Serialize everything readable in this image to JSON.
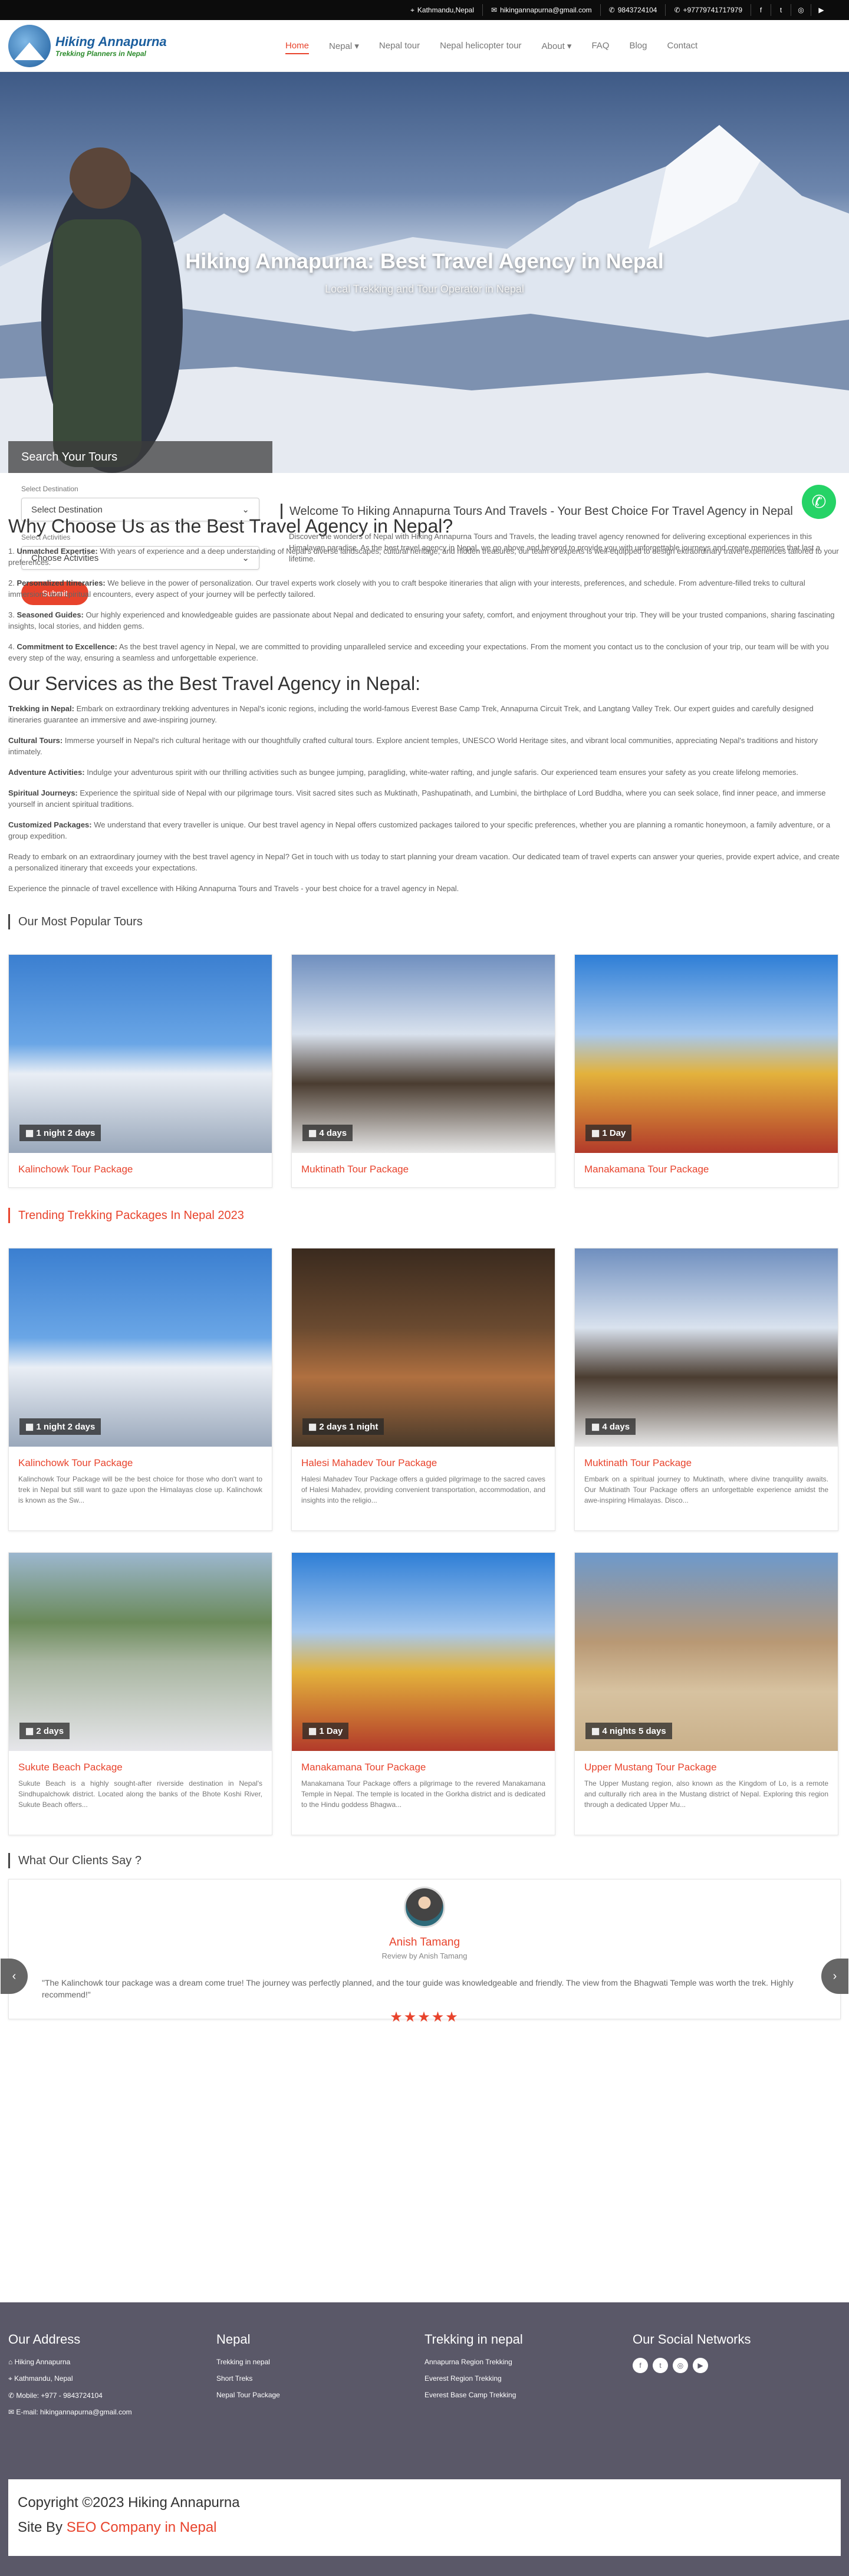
{
  "topbar": {
    "location": "Kathmandu,Nepal",
    "email": "hikingannapurna@gmail.com",
    "phone1": "9843724104",
    "phone2": "+97779741717979"
  },
  "logo": {
    "title": "Hiking Annapurna",
    "tagline": "Trekking Planners in Nepal"
  },
  "nav": [
    "Home",
    "Nepal ▾",
    "Nepal tour",
    "Nepal helicopter tour",
    "About ▾",
    "FAQ",
    "Blog",
    "Contact"
  ],
  "hero": {
    "title": "Hiking Annapurna: Best Travel Agency in Nepal",
    "subtitle": "Local Trekking and Tour Operator in Nepal"
  },
  "search": {
    "title": "Search Your Tours",
    "dest_label": "Select Destination",
    "dest_value": "Select Destination",
    "act_label": "Select Activities",
    "act_value": "Choose Activities",
    "submit": "Submit"
  },
  "welcome": {
    "title": "Welcome To Hiking Annapurna Tours And Travels - Your Best Choice For Travel Agency in Nepal",
    "text": "Discover the wonders of Nepal with Hiking Annapurna Tours and Travels, the leading travel agency renowned for delivering exceptional experiences in this Himalayan paradise. As the best travel agency in Nepal, we go above and beyond to provide you with unforgettable journeys and create memories that last a lifetime."
  },
  "why": {
    "title": "Why Choose Us as the Best Travel Agency in Nepal?",
    "items": [
      {
        "n": "1.",
        "h": "Unmatched Expertise:",
        "t": "With years of experience and a deep understanding of Nepal's diverse landscapes, cultural heritage, and hidden treasures, our team of experts is well-equipped to design extraordinary travel experiences tailored to your preferences."
      },
      {
        "n": "2.",
        "h": "Personalized Itineraries:",
        "t": "We believe in the power of personalization. Our travel experts work closely with you to craft bespoke itineraries that align with your interests, preferences, and schedule. From adventure-filled treks to cultural immersions and spiritual encounters, every aspect of your journey will be perfectly tailored."
      },
      {
        "n": "3.",
        "h": "Seasoned Guides:",
        "t": "Our highly experienced and knowledgeable guides are passionate about Nepal and dedicated to ensuring your safety, comfort, and enjoyment throughout your trip. They will be your trusted companions, sharing fascinating insights, local stories, and hidden gems."
      },
      {
        "n": "4.",
        "h": "Commitment to Excellence:",
        "t": "As the best travel agency in Nepal, we are committed to providing unparalleled service and exceeding your expectations. From the moment you contact us to the conclusion of your trip, our team will be with you every step of the way, ensuring a seamless and unforgettable experience."
      }
    ]
  },
  "services": {
    "title": "Our Services as the Best Travel Agency in Nepal:",
    "items": [
      {
        "h": "Trekking in Nepal:",
        "t": "Embark on extraordinary trekking adventures in Nepal's iconic regions, including the world-famous Everest Base Camp Trek, Annapurna Circuit Trek, and Langtang Valley Trek. Our expert guides and carefully designed itineraries guarantee an immersive and awe-inspiring journey."
      },
      {
        "h": "Cultural Tours:",
        "t": "Immerse yourself in Nepal's rich cultural heritage with our thoughtfully crafted cultural tours. Explore ancient temples, UNESCO World Heritage sites, and vibrant local communities, appreciating Nepal's traditions and history intimately."
      },
      {
        "h": "Adventure Activities:",
        "t": "Indulge your adventurous spirit with our thrilling activities such as bungee jumping, paragliding, white-water rafting, and jungle safaris. Our experienced team ensures your safety as you create lifelong memories."
      },
      {
        "h": "Spiritual Journeys:",
        "t": "Experience the spiritual side of Nepal with our pilgrimage tours. Visit sacred sites such as Muktinath, Pashupatinath, and Lumbini, the birthplace of Lord Buddha, where you can seek solace, find inner peace, and immerse yourself in ancient spiritual traditions."
      },
      {
        "h": "Customized Packages:",
        "t": "We understand that every traveller is unique. Our best travel agency in Nepal offers customized packages tailored to your specific preferences, whether you are planning a romantic honeymoon, a family adventure, or a group expedition."
      }
    ],
    "p1": "Ready to embark on an extraordinary journey with the best travel agency in Nepal? Get in touch with us today to start planning your dream vacation. Our dedicated team of travel experts can answer your queries, provide expert advice, and create a personalized itinerary that exceeds your expectations.",
    "p2": "Experience the pinnacle of travel excellence with Hiking Annapurna Tours and Travels - your best choice for a travel agency in Nepal."
  },
  "popular": {
    "title": "Our Most Popular Tours",
    "cards": [
      {
        "dur": "1 night 2 days",
        "name": "Kalinchowk Tour Package"
      },
      {
        "dur": "4 days",
        "name": "Muktinath Tour Package"
      },
      {
        "dur": "1 Day",
        "name": "Manakamana Tour Package"
      }
    ]
  },
  "trending": {
    "title": "Trending Trekking Packages In Nepal 2023",
    "cards": [
      {
        "dur": "1 night 2 days",
        "name": "Kalinchowk Tour Package",
        "desc": "Kalinchowk Tour Package will be the best choice for those who don't want to trek in Nepal but still want to gaze upon the Himalayas close up. Kalinchowk is known as the Sw..."
      },
      {
        "dur": "2 days 1 night",
        "name": "Halesi Mahadev Tour Package",
        "desc": "Halesi Mahadev Tour Package offers a guided pilgrimage to the sacred caves of Halesi Mahadev, providing convenient transportation, accommodation, and insights into the religio..."
      },
      {
        "dur": "4 days",
        "name": "Muktinath Tour Package",
        "desc": "Embark on a spiritual journey to Muktinath, where divine tranquility awaits. Our Muktinath Tour Package offers an unforgettable experience amidst the awe-inspiring Himalayas. Disco..."
      },
      {
        "dur": "2 days",
        "name": "Sukute Beach Package",
        "desc": "Sukute Beach is a highly sought-after riverside destination in Nepal's Sindhupalchowk district. Located along the banks of the Bhote Koshi River, Sukute Beach offers..."
      },
      {
        "dur": "1 Day",
        "name": "Manakamana Tour Package",
        "desc": "Manakamana Tour Package offers a pilgrimage to the revered Manakamana Temple in Nepal. The temple is located in the Gorkha district and is dedicated to the Hindu goddess Bhagwa..."
      },
      {
        "dur": "4 nights 5 days",
        "name": "Upper Mustang Tour Package",
        "desc": "The Upper Mustang region, also known as the Kingdom of Lo, is a remote and culturally rich area in the Mustang district of Nepal. Exploring this region through a dedicated Upper Mu..."
      }
    ]
  },
  "clients": {
    "title": "What Our Clients Say ?",
    "name": "Anish Tamang",
    "review": "Review by Anish Tamang",
    "text": "\"The Kalinchowk tour package was a dream come true! The journey was perfectly planned, and the tour guide was knowledgeable and friendly. The view from the Bhagwati Temple was worth the trek. Highly recommend!\"",
    "stars": "★★★★★"
  },
  "footer": {
    "addr_title": "Our Address",
    "addr": [
      "Hiking Annapurna",
      "Kathmandu, Nepal",
      "Mobile: +977 - 9843724104",
      "E-mail: hikingannapurna@gmail.com"
    ],
    "nepal_title": "Nepal",
    "nepal": [
      "Trekking in nepal",
      "Short Treks",
      "Nepal Tour Package"
    ],
    "trek_title": "Trekking in nepal",
    "trek": [
      "Annapurna Region Trekking",
      "Everest Region Trekking",
      "Everest Base Camp Trekking"
    ],
    "soc_title": "Our Social Networks",
    "copy": "Copyright ©2023 Hiking Annapurna",
    "site_pre": "Site By",
    "site_link": "SEO Company in Nepal"
  }
}
